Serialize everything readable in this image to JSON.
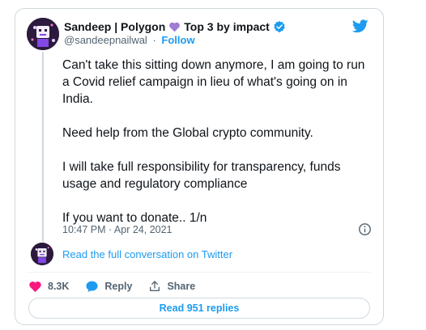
{
  "author": {
    "name": "Sandeep | Polygon",
    "name_suffix": "Top 3 by impact",
    "handle": "@sandeepnailwal",
    "separator": "·",
    "follow_label": "Follow"
  },
  "tweet": {
    "paragraphs": [
      "Can't take this sitting down anymore, I am going to run a Covid relief campaign in lieu of what's going on in India.",
      "Need help from the Global crypto community.",
      "I will take full responsibility for transparency, funds usage and regulatory compliance",
      "If you want to donate.. 1/n"
    ],
    "timestamp": "10:47 PM · Apr 24, 2021"
  },
  "conversation_link": "Read the full conversation on Twitter",
  "actions": {
    "like_count": "8.3K",
    "reply_label": "Reply",
    "share_label": "Share"
  },
  "read_replies_label": "Read 951 replies",
  "colors": {
    "twitter_blue": "#1d9bf0",
    "like_pink": "#f91880",
    "heart_purple": "#a07cd4",
    "text_dark": "#0f1419",
    "text_gray": "#536471",
    "border": "#cfd9de"
  },
  "icons": {
    "header": [
      "purple-heart-icon",
      "verified-badge-icon",
      "twitter-bird-icon"
    ],
    "actions": [
      "heart-icon",
      "reply-bubble-icon",
      "share-upload-icon"
    ],
    "other": [
      "info-icon"
    ]
  }
}
